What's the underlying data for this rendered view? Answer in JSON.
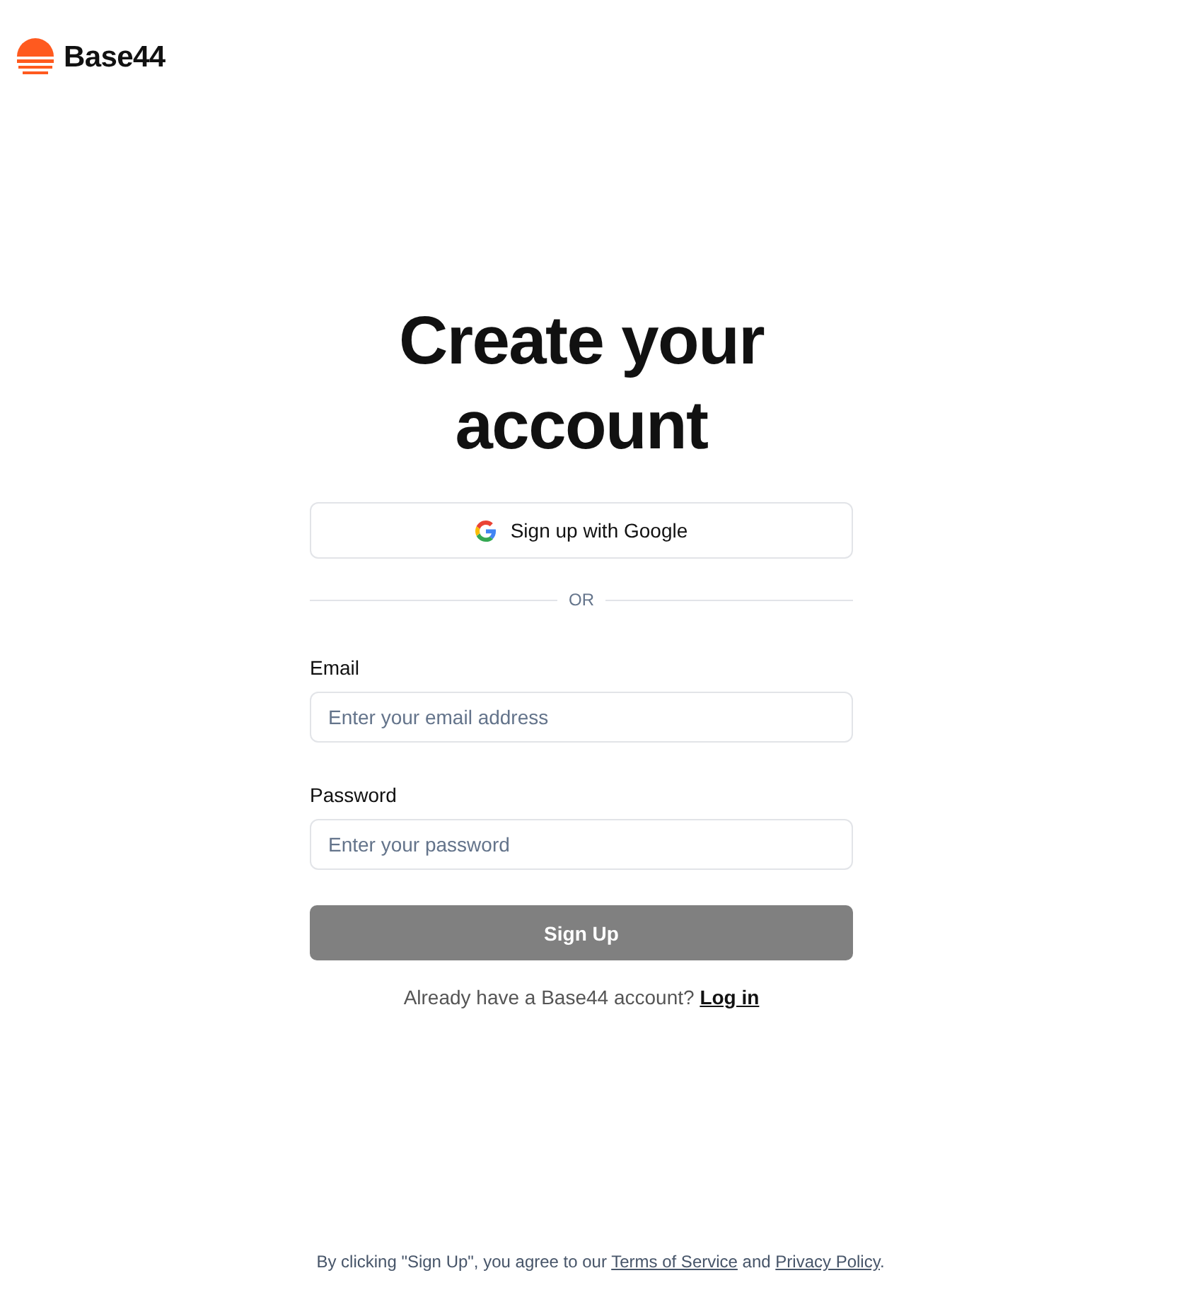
{
  "brand": {
    "name": "Base44"
  },
  "title": "Create your account",
  "google_button": {
    "label": "Sign up with Google"
  },
  "divider": {
    "label": "OR"
  },
  "fields": [
    {
      "label": "Email",
      "placeholder": "Enter your email address"
    },
    {
      "label": "Password",
      "placeholder": "Enter your password"
    }
  ],
  "submit_button": {
    "label": "Sign Up",
    "disabled": true
  },
  "login_prompt": {
    "text": "Already have a Base44 account?",
    "link": "Log in"
  },
  "footer": {
    "text_before": "By clicking \"Sign Up\", you agree to our",
    "terms": "Terms of Service",
    "middle": "and",
    "privacy": "Privacy Policy",
    "end": "."
  }
}
